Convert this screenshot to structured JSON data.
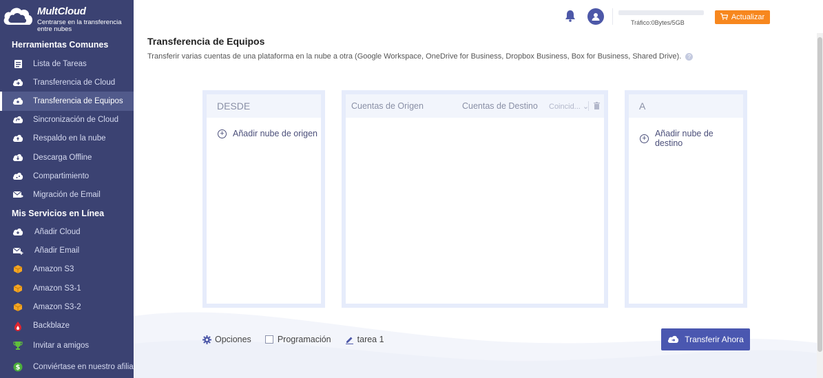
{
  "brand": {
    "name": "MultCloud",
    "tagline": "Centrarse en la transferencia entre nubes"
  },
  "sidebar": {
    "section1_title": "Herramientas Comunes",
    "tools": [
      {
        "label": "Lista de Tareas",
        "icon": "task-list-icon"
      },
      {
        "label": "Transferencia de Cloud",
        "icon": "cloud-transfer-icon"
      },
      {
        "label": "Transferencia de Equipos",
        "icon": "team-transfer-icon",
        "active": true
      },
      {
        "label": "Sincronización de Cloud",
        "icon": "cloud-sync-icon"
      },
      {
        "label": "Respaldo en la nube",
        "icon": "cloud-backup-icon"
      },
      {
        "label": "Descarga Offline",
        "icon": "offline-download-icon"
      },
      {
        "label": "Compartimiento",
        "icon": "share-icon"
      },
      {
        "label": "Migración de Email",
        "icon": "email-migration-icon"
      }
    ],
    "section2_title": "Mis Servicios en Línea",
    "services": [
      {
        "label": "Añadir Cloud",
        "icon": "add-cloud-icon"
      },
      {
        "label": "Añadir Email",
        "icon": "add-email-icon"
      },
      {
        "label": "Amazon S3",
        "icon": "amazon-s3-icon"
      },
      {
        "label": "Amazon S3-1",
        "icon": "amazon-s3-icon"
      },
      {
        "label": "Amazon S3-2",
        "icon": "amazon-s3-icon"
      },
      {
        "label": "Backblaze",
        "icon": "backblaze-icon"
      },
      {
        "label": "Invitar a amigos",
        "icon": "trophy-icon"
      },
      {
        "label": "Conviértase en nuestro afilia",
        "icon": "dollar-icon"
      }
    ]
  },
  "header": {
    "traffic_text": "Tráfico:0Bytes/5GB",
    "traffic_used_fraction": 0,
    "upgrade_label": "Actualizar"
  },
  "main": {
    "title": "Transferencia de Equipos",
    "description": "Transferir varias cuentas de una plataforma en la nube a otra (Google Workspace, OneDrive for Business, Dropbox Business, Box for Business, Shared Drive).",
    "from_title": "DESDE",
    "add_source": "Añadir nube de origen",
    "source_accounts": "Cuentas de Origen",
    "target_accounts": "Cuentas de Destino",
    "match_label": "Coincid...",
    "to_title": "A",
    "add_target": "Añadir nube de destino",
    "options_label": "Opciones",
    "schedule_label": "Programación",
    "task_name": "tarea 1",
    "transfer_button": "Transferir Ahora"
  },
  "colors": {
    "sidebar_bg": "#3b4272",
    "accent": "#4a57b0",
    "upgrade": "#f7871e"
  }
}
